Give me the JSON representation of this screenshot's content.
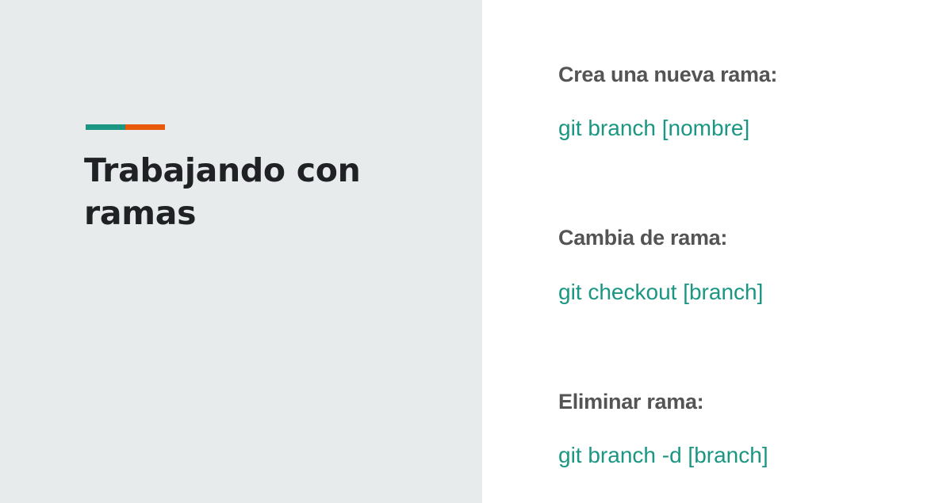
{
  "colors": {
    "left_background": "#e8ebec",
    "right_background": "#ffffff",
    "title": "#1f2125",
    "heading": "#545454",
    "command": "#1a9683",
    "accent_teal": "#1a9683",
    "accent_orange": "#e8590c"
  },
  "slide": {
    "title": "Trabajando con ramas"
  },
  "commands": [
    {
      "heading": "Crea una nueva rama:",
      "code": "git branch [nombre]"
    },
    {
      "heading": "Cambia de rama:",
      "code": "git checkout [branch]"
    },
    {
      "heading": "Eliminar rama:",
      "code": "git branch -d [branch]"
    }
  ]
}
